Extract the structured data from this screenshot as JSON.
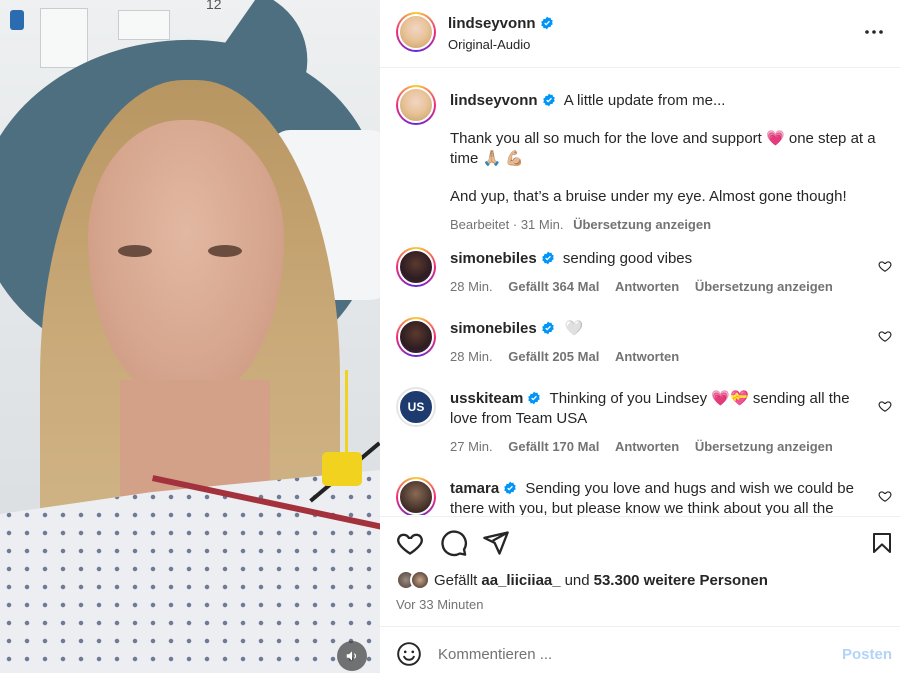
{
  "media": {
    "wall_number": "12"
  },
  "post": {
    "username": "lindseyvonn",
    "audio": "Original-Audio",
    "more_icon": "more-icon",
    "caption_line1": "A little update from me...",
    "caption_line2": "Thank you all so much for the love and support 💗 one step at a time 🙏🏼 💪🏼",
    "caption_line3": "And yup, that’s a bruise under my eye. Almost gone though!",
    "caption_meta_edited": "Bearbeitet · 31 Min.",
    "caption_meta_translate": "Übersetzung anzeigen"
  },
  "comments": [
    {
      "username": "simonebiles",
      "text": "sending good vibes",
      "time": "28 Min.",
      "likes": "Gefällt 364 Mal",
      "reply": "Antworten",
      "translate": "Übersetzung anzeigen"
    },
    {
      "username": "simonebiles",
      "text": "🤍",
      "time": "28 Min.",
      "likes": "Gefällt 205 Mal",
      "reply": "Antworten"
    },
    {
      "username": "usskiteam",
      "text": "Thinking of you Lindsey 💗💝 sending all the love from Team USA",
      "time": "27 Min.",
      "likes": "Gefällt 170 Mal",
      "reply": "Antworten",
      "translate": "Übersetzung anzeigen",
      "avatar_text": "US"
    },
    {
      "username": "tamara",
      "text": "Sending you love and hugs and wish we could be there with you, but please know we think about you all the"
    }
  ],
  "likes": {
    "prefix": "Gefällt",
    "user": "aa_liiciiaa_",
    "middle": "und",
    "count": "53.300 weitere Personen"
  },
  "timestamp": "Vor 33 Minuten",
  "comment_bar": {
    "placeholder": "Kommentieren ...",
    "post_label": "Posten"
  },
  "colors": {
    "verified": "#0095f6",
    "post_disabled": "#b3d3f8",
    "secondary_text": "#737373"
  }
}
